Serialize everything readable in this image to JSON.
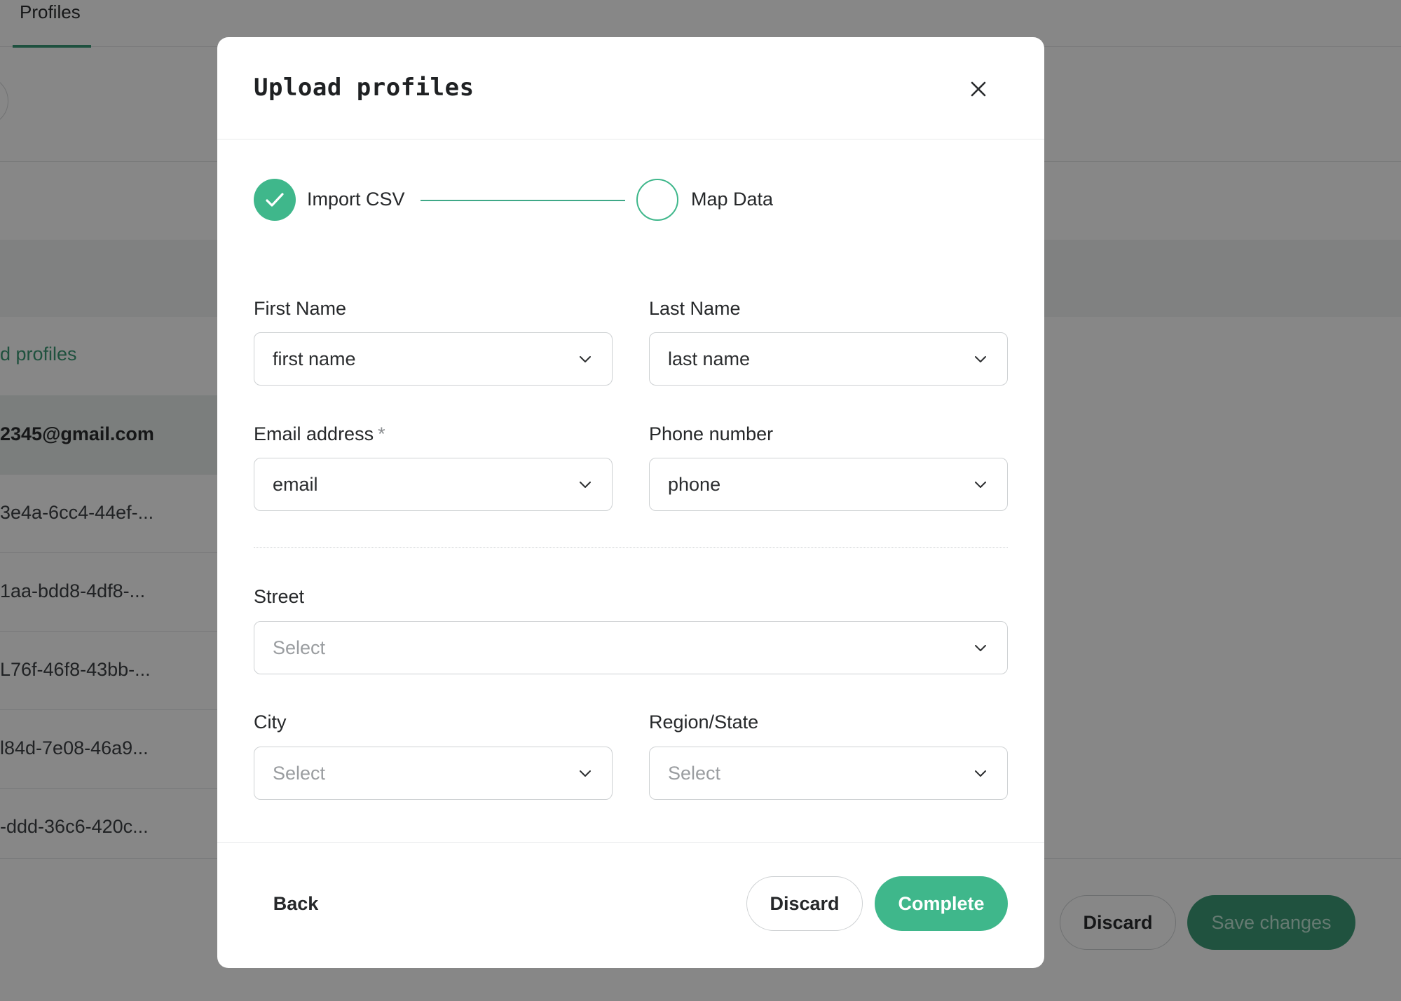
{
  "background": {
    "tab_label": "Profiles",
    "uploaded_link": "d profiles",
    "rows": [
      "2345@gmail.com",
      "3e4a-6cc4-44ef-...",
      "1aa-bdd8-4df8-...",
      "L76f-46f8-43bb-...",
      "l84d-7e08-46a9...",
      "-ddd-36c6-420c..."
    ],
    "discard_label": "Discard",
    "save_label": "Save changes"
  },
  "modal": {
    "title": "Upload profiles",
    "close_icon": "close-icon",
    "steps": [
      {
        "label": "Import CSV",
        "status": "complete"
      },
      {
        "label": "Map Data",
        "status": "current"
      }
    ],
    "fields": {
      "first_name": {
        "label": "First Name",
        "value": "first name"
      },
      "last_name": {
        "label": "Last Name",
        "value": "last name"
      },
      "email": {
        "label": "Email address",
        "required_mark": "*",
        "value": "email"
      },
      "phone": {
        "label": "Phone number",
        "value": "phone"
      },
      "street": {
        "label": "Street",
        "placeholder": "Select"
      },
      "city": {
        "label": "City",
        "placeholder": "Select"
      },
      "region": {
        "label": "Region/State",
        "placeholder": "Select"
      }
    },
    "footer": {
      "back_label": "Back",
      "discard_label": "Discard",
      "complete_label": "Complete"
    }
  },
  "colors": {
    "accent": "#3fb78b",
    "dark_accent": "#3d9b78",
    "overlay": "rgba(0,0,0,0.47)"
  }
}
